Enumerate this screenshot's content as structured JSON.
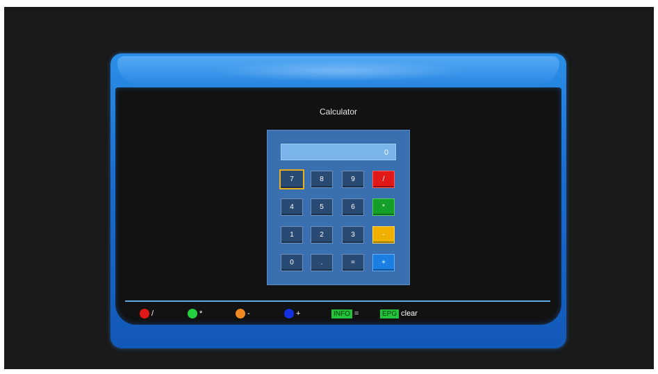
{
  "screen": {
    "title": "Calculator",
    "colors": {
      "frame": "#1a6fd0",
      "panel": "#3a6fb0",
      "display": "#7ab4ea",
      "key": "#294a73",
      "selection": "#e8b020"
    }
  },
  "calculator": {
    "display_value": "0",
    "keys": {
      "k7": "7",
      "k8": "8",
      "k9": "9",
      "div": "/",
      "k4": "4",
      "k5": "5",
      "k6": "6",
      "mul": "*",
      "k1": "1",
      "k2": "2",
      "k3": "3",
      "sub": "-",
      "k0": "0",
      "dot": ".",
      "eq": "=",
      "add": "+"
    },
    "selected_key": "7"
  },
  "legend": {
    "red": {
      "symbol": "/",
      "color": "#e01818",
      "icon": "red-dot"
    },
    "green": {
      "symbol": "*",
      "color": "#22d040",
      "icon": "green-dot"
    },
    "orange": {
      "symbol": "-",
      "color": "#f08a20",
      "icon": "orange-dot"
    },
    "blue": {
      "symbol": "+",
      "color": "#1530e0",
      "icon": "blue-dot"
    },
    "info": {
      "tag": "INFO",
      "symbol": "="
    },
    "epg": {
      "tag": "EPG",
      "symbol": "clear"
    }
  }
}
